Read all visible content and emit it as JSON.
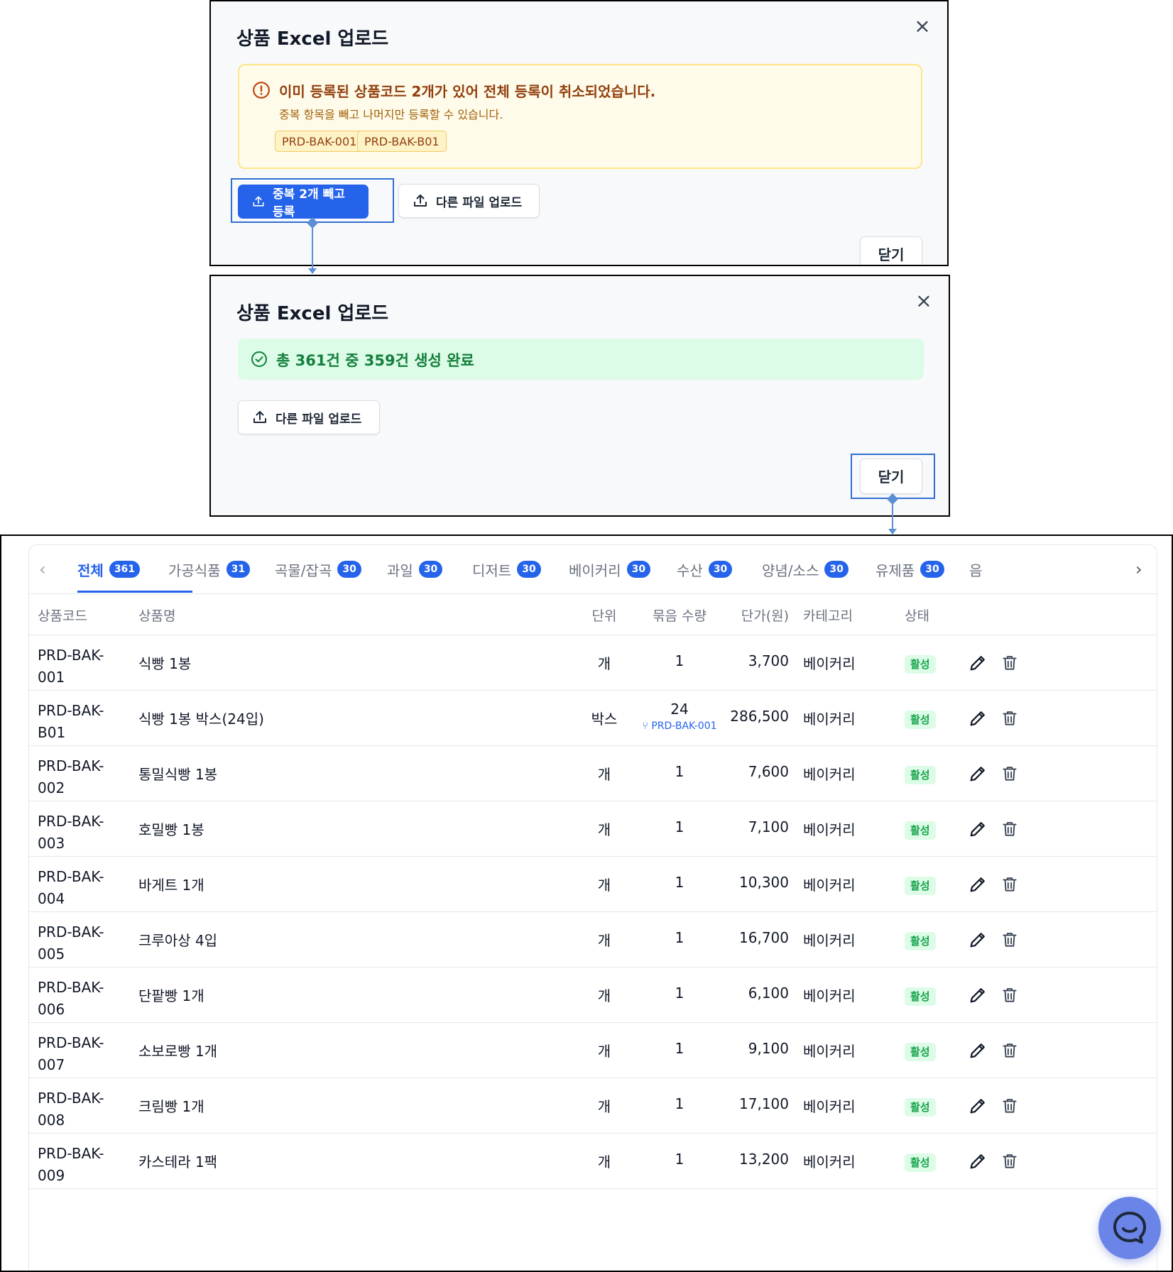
{
  "modal1": {
    "title": "상품 Excel 업로드",
    "close_symbol": "×",
    "warning": {
      "title": "이미 등록된 상품코드 2개가 있어 전체 등록이 취소되었습니다.",
      "subtitle": "중복 항목을 빼고 나머지만 등록할 수 있습니다.",
      "codes": [
        "PRD-BAK-001",
        "PRD-BAK-B01"
      ]
    },
    "primary_button": "중복 2개 빼고 등록",
    "secondary_button": "다른 파일 업로드",
    "close_button": "닫기"
  },
  "modal2": {
    "title": "상품 Excel 업로드",
    "close_symbol": "×",
    "success_message": "총 361건 중 359건 생성 완료",
    "secondary_button": "다른 파일 업로드",
    "close_button": "닫기"
  },
  "tabs": [
    {
      "label": "전체",
      "count": "361",
      "active": true
    },
    {
      "label": "가공식품",
      "count": "31"
    },
    {
      "label": "곡물/잡곡",
      "count": "30"
    },
    {
      "label": "과일",
      "count": "30"
    },
    {
      "label": "디저트",
      "count": "30"
    },
    {
      "label": "베이커리",
      "count": "30"
    },
    {
      "label": "수산",
      "count": "30"
    },
    {
      "label": "양념/소스",
      "count": "30"
    },
    {
      "label": "유제품",
      "count": "30"
    },
    {
      "label": "음",
      "count": ""
    }
  ],
  "tab_prev": "‹",
  "tab_next": "›",
  "table": {
    "headers": {
      "code": "상품코드",
      "name": "상품명",
      "unit": "단위",
      "bundle_qty": "묶음 수량",
      "price": "단가(원)",
      "category": "카테고리",
      "status": "상태"
    },
    "rows": [
      {
        "code1": "PRD-BAK-",
        "code2": "001",
        "name": "식빵 1봉",
        "unit": "개",
        "qty": "1",
        "qty_link": "",
        "price": "3,700",
        "category": "베이커리",
        "status": "활성"
      },
      {
        "code1": "PRD-BAK-",
        "code2": "B01",
        "name": "식빵 1봉 박스(24입)",
        "unit": "박스",
        "qty": "24",
        "qty_link": "PRD-BAK-001",
        "price": "286,500",
        "category": "베이커리",
        "status": "활성"
      },
      {
        "code1": "PRD-BAK-",
        "code2": "002",
        "name": "통밀식빵 1봉",
        "unit": "개",
        "qty": "1",
        "qty_link": "",
        "price": "7,600",
        "category": "베이커리",
        "status": "활성"
      },
      {
        "code1": "PRD-BAK-",
        "code2": "003",
        "name": "호밀빵 1봉",
        "unit": "개",
        "qty": "1",
        "qty_link": "",
        "price": "7,100",
        "category": "베이커리",
        "status": "활성"
      },
      {
        "code1": "PRD-BAK-",
        "code2": "004",
        "name": "바게트 1개",
        "unit": "개",
        "qty": "1",
        "qty_link": "",
        "price": "10,300",
        "category": "베이커리",
        "status": "활성"
      },
      {
        "code1": "PRD-BAK-",
        "code2": "005",
        "name": "크루아상 4입",
        "unit": "개",
        "qty": "1",
        "qty_link": "",
        "price": "16,700",
        "category": "베이커리",
        "status": "활성"
      },
      {
        "code1": "PRD-BAK-",
        "code2": "006",
        "name": "단팥빵 1개",
        "unit": "개",
        "qty": "1",
        "qty_link": "",
        "price": "6,100",
        "category": "베이커리",
        "status": "활성"
      },
      {
        "code1": "PRD-BAK-",
        "code2": "007",
        "name": "소보로빵 1개",
        "unit": "개",
        "qty": "1",
        "qty_link": "",
        "price": "9,100",
        "category": "베이커리",
        "status": "활성"
      },
      {
        "code1": "PRD-BAK-",
        "code2": "008",
        "name": "크림빵 1개",
        "unit": "개",
        "qty": "1",
        "qty_link": "",
        "price": "17,100",
        "category": "베이커리",
        "status": "활성"
      },
      {
        "code1": "PRD-BAK-",
        "code2": "009",
        "name": "카스테라 1팩",
        "unit": "개",
        "qty": "1",
        "qty_link": "",
        "price": "13,200",
        "category": "베이커리",
        "status": "활성"
      }
    ]
  },
  "colors": {
    "primary": "#2563eb",
    "warning_bg": "#fffbeb",
    "warning_text": "#92400e",
    "success_bg": "#dcfce7",
    "success_text": "#15803d",
    "highlight": "#2f6fd1"
  }
}
